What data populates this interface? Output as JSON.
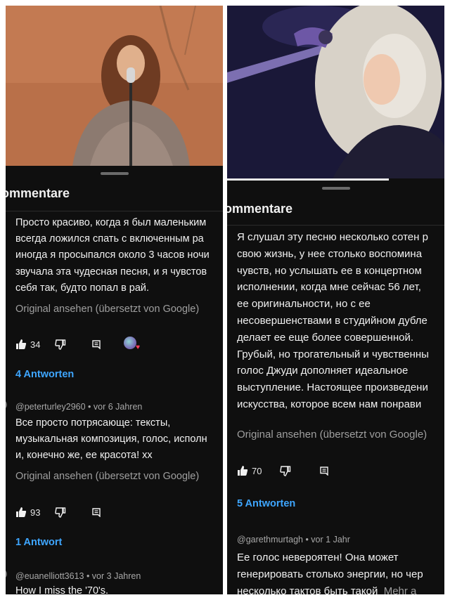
{
  "left": {
    "section_title": "ommentare",
    "comments": [
      {
        "text_lines": [
          "Просто красиво, когда я был маленьким",
          "всегда ложился спать с включенным ра",
          "иногда я просыпался около 3 часов ночи",
          "звучала эта чудесная песня, и я чувстов",
          "себя так, будто попал в рай."
        ],
        "translate": "Original ansehen (übersetzt von Google)",
        "likes": "34",
        "replies": "4 Antworten",
        "creator_heart": true
      },
      {
        "meta": "@peterturley2960 • vor 6 Jahren",
        "text_lines": [
          "Все просто потрясающе: тексты,",
          "музыкальная композиция, голос, исполн",
          "и, конечно же, ее красота! хх"
        ],
        "translate": "Original ansehen (übersetzt von Google)",
        "likes": "93",
        "replies": "1 Antwort"
      },
      {
        "meta": "@euanelliott3613 • vor 3 Jahren",
        "text_lines": [
          "How I miss the '70's."
        ]
      }
    ]
  },
  "right": {
    "section_title": "ommentare",
    "comments": [
      {
        "text_lines": [
          "Я слушал эту песню несколько сотен р",
          "свою жизнь, у нее столько воспомина",
          "чувств, но услышать ее в концертном",
          "исполнении, когда мне сейчас 56 лет,",
          "ее оригинальности, но с ее",
          "несовершенствами в студийном дубле",
          "делает ее еще более совершенной.",
          "Грубый, но трогательный и чувственны",
          "голос Джуди дополняет идеальное",
          "выступление. Настоящее произведени",
          "искусства, которое всем нам понрави"
        ],
        "translate": "Original ansehen (übersetzt von Google)",
        "likes": "70",
        "replies": "5 Antworten"
      },
      {
        "meta": "@garethmurtagh • vor 1 Jahr",
        "text_lines": [
          "Ее голос невероятен! Она может",
          "генерировать столько энергии, но чер",
          "несколько тактов быть такой"
        ],
        "more": "Mehr a"
      }
    ]
  },
  "colors": {
    "background": "#0f0f0f",
    "text": "#f1f1f1",
    "secondary_text": "#9f9f9f",
    "link_blue": "#3ea6ff"
  },
  "icons": [
    "thumbs-up-icon",
    "thumbs-down-icon",
    "reply-icon",
    "creator-heart-icon",
    "drag-handle-icon"
  ]
}
